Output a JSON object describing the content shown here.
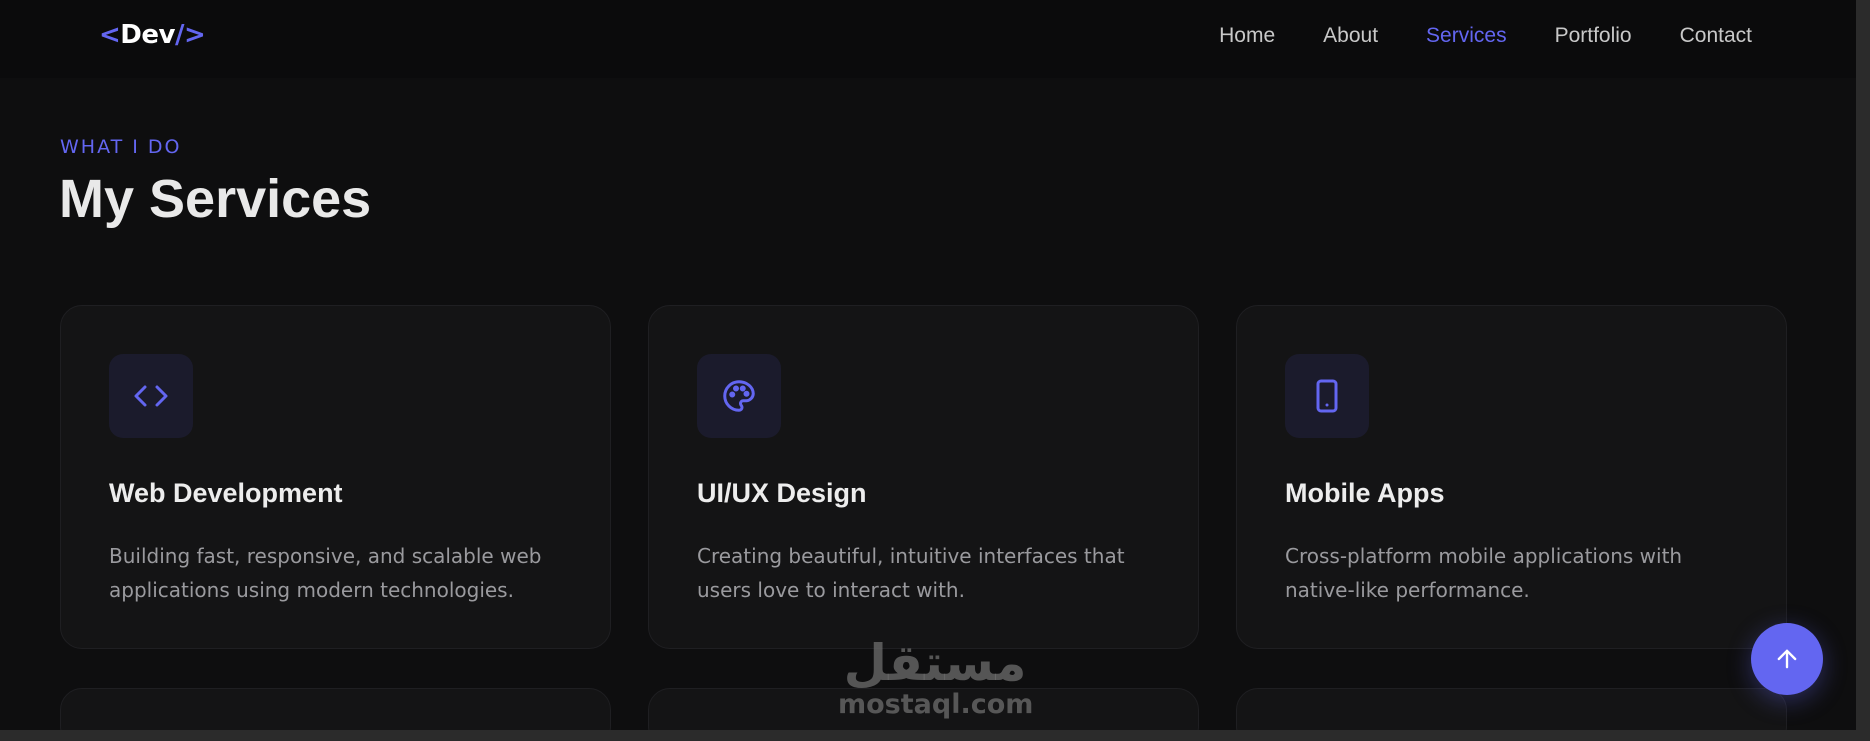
{
  "logo": {
    "open": "<",
    "text": "Dev",
    "close": "/>"
  },
  "nav": {
    "items": [
      {
        "label": "Home",
        "active": false
      },
      {
        "label": "About",
        "active": false
      },
      {
        "label": "Services",
        "active": true
      },
      {
        "label": "Portfolio",
        "active": false
      },
      {
        "label": "Contact",
        "active": false
      }
    ]
  },
  "section": {
    "eyebrow": "WHAT I DO",
    "title": "My Services"
  },
  "services": [
    {
      "icon": "code-icon",
      "title": "Web Development",
      "description": "Building fast, responsive, and scalable web applications using modern technologies."
    },
    {
      "icon": "palette-icon",
      "title": "UI/UX Design",
      "description": "Creating beautiful, intuitive interfaces that users love to interact with."
    },
    {
      "icon": "mobile-icon",
      "title": "Mobile Apps",
      "description": "Cross-platform mobile applications with native-like performance."
    }
  ],
  "watermark": {
    "arabic": "مستقل",
    "latin": "mostaql.com"
  },
  "colors": {
    "accent": "#6366f1",
    "background": "#0e0e0f",
    "card": "#141415"
  }
}
